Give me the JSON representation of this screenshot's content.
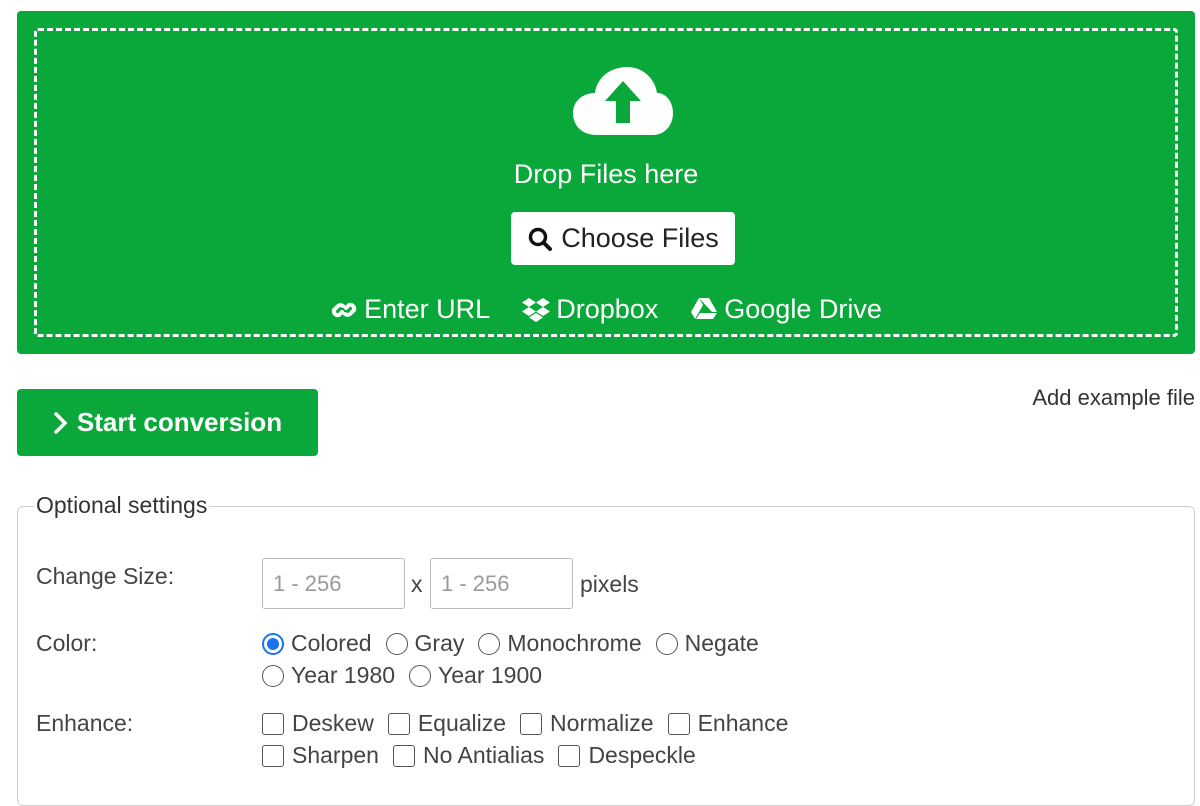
{
  "upload": {
    "drop_text": "Drop Files here",
    "choose_label": "Choose Files",
    "sources": [
      "Enter URL",
      "Dropbox",
      "Google Drive"
    ]
  },
  "actions": {
    "start_label": "Start conversion",
    "example_label": "Add example file"
  },
  "settings": {
    "legend": "Optional settings",
    "size": {
      "label": "Change Size:",
      "width_placeholder": "1 - 256",
      "height_placeholder": "1 - 256",
      "separator": "x",
      "unit": "pixels"
    },
    "color": {
      "label": "Color:",
      "options": [
        "Colored",
        "Gray",
        "Monochrome",
        "Negate",
        "Year 1980",
        "Year 1900"
      ],
      "selected": "Colored"
    },
    "enhance": {
      "label": "Enhance:",
      "options": [
        "Deskew",
        "Equalize",
        "Normalize",
        "Enhance",
        "Sharpen",
        "No Antialias",
        "Despeckle"
      ]
    }
  },
  "colors": {
    "brand_green": "#0aa83a",
    "radio_blue": "#1a73e8"
  }
}
